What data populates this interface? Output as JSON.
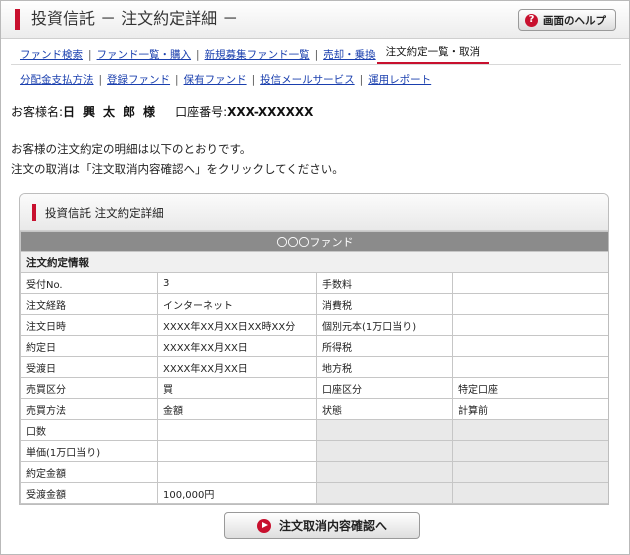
{
  "header": {
    "title": "投資信託 － 注文約定詳細 －",
    "help_label": "画面のヘルプ",
    "help_icon": "question-icon",
    "accent_color": "#c8102e"
  },
  "nav1": [
    {
      "label": "ファンド検索",
      "active": false
    },
    {
      "label": "ファンド一覧・購入",
      "active": false
    },
    {
      "label": "新規募集ファンド一覧",
      "active": false
    },
    {
      "label": "売却・乗換",
      "active": false
    },
    {
      "label": "注文約定一覧・取消",
      "active": true
    }
  ],
  "nav2": [
    {
      "label": "分配金支払方法"
    },
    {
      "label": "登録ファンド"
    },
    {
      "label": "保有ファンド"
    },
    {
      "label": "投信メールサービス"
    },
    {
      "label": "運用レポート"
    }
  ],
  "customer": {
    "label": "お客様名:",
    "name": "日興太郎様",
    "account_label": "口座番号:",
    "account_number": "XXX-XXXXXX"
  },
  "messages": [
    "お客様の注文約定の明細は以下のとおりです。",
    "注文の取消は「注文取消内容確認へ」をクリックしてください。"
  ],
  "panel": {
    "title": "投資信託 注文約定詳細",
    "fund_name": "〇〇〇ファンド",
    "section_title": "注文約定情報",
    "rows": [
      {
        "l1": "受付No.",
        "v1": "3",
        "l2": "手数料",
        "v2": ""
      },
      {
        "l1": "注文経路",
        "v1": "インターネット",
        "l2": "消費税",
        "v2": ""
      },
      {
        "l1": "注文日時",
        "v1": "XXXX年XX月XX日XX時XX分",
        "l2": "個別元本(1万口当り)",
        "v2": ""
      },
      {
        "l1": "約定日",
        "v1": "XXXX年XX月XX日",
        "l2": "所得税",
        "v2": ""
      },
      {
        "l1": "受渡日",
        "v1": "XXXX年XX月XX日",
        "l2": "地方税",
        "v2": ""
      },
      {
        "l1": "売買区分",
        "v1": "買",
        "l2": "口座区分",
        "v2": "特定口座"
      },
      {
        "l1": "売買方法",
        "v1": "金額",
        "l2": "状態",
        "v2": "計算前"
      },
      {
        "l1": "口数",
        "v1": "",
        "l2": "",
        "v2": ""
      },
      {
        "l1": "単価(1万口当り)",
        "v1": "",
        "l2": "",
        "v2": ""
      },
      {
        "l1": "約定金額",
        "v1": "",
        "l2": "",
        "v2": ""
      },
      {
        "l1": "受渡金額",
        "v1": "100,000円",
        "l2": "",
        "v2": ""
      }
    ]
  },
  "confirm_button": {
    "label": "注文取消内容確認へ",
    "icon": "play-icon"
  }
}
